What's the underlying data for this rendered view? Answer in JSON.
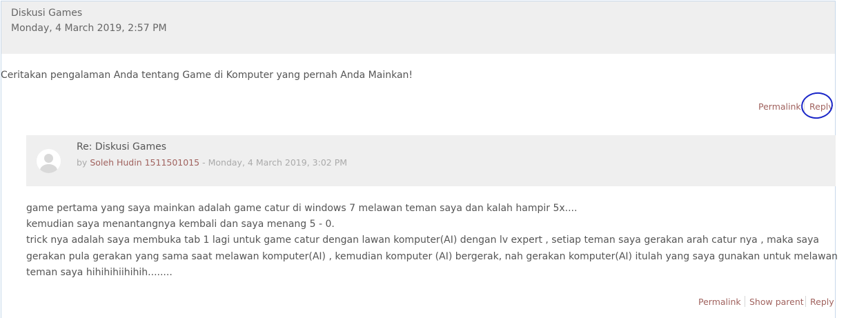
{
  "post": {
    "subject": "Diskusi Games",
    "date": "Monday, 4 March 2019, 2:57 PM",
    "body": "Ceritakan pengalaman Anda tentang Game di Komputer yang pernah Anda Mainkan!",
    "commands": {
      "permalink": "Permalink",
      "reply": "Reply"
    }
  },
  "reply": {
    "subject": "Re: Diskusi Games",
    "by_prefix": "by",
    "author": "Soleh Hudin 1511501015",
    "date_sep": "- Monday, 4 March 2019, 3:02 PM",
    "body_lines": [
      "game pertama yang saya mainkan adalah game catur di windows 7 melawan teman saya dan kalah hampir 5x....",
      "kemudian saya menantangnya kembali dan saya menang 5 - 0.",
      "trick nya adalah saya membuka tab 1 lagi untuk game catur dengan lawan komputer(AI) dengan lv expert , setiap teman saya gerakan arah catur nya , maka saya",
      "gerakan pula gerakan yang sama saat melawan komputer(AI) , kemudian komputer (AI) bergerak, nah gerakan komputer(AI) itulah yang saya gunakan untuk melawan",
      "teman saya hihihihiihihih........"
    ],
    "commands": {
      "permalink": "Permalink",
      "show_parent": "Show parent",
      "reply": "Reply"
    }
  },
  "colors": {
    "link": "#a0625e",
    "header_bg": "#efefef",
    "annotation": "#1a26c8"
  },
  "icons": {
    "avatar": "default-user-avatar-icon"
  }
}
